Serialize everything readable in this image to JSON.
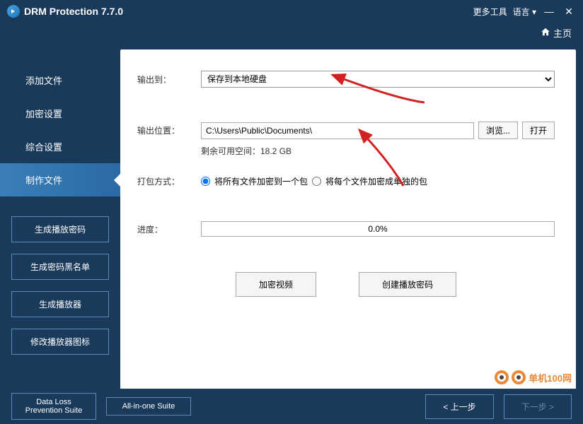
{
  "titlebar": {
    "title": "DRM Protection 7.7.0",
    "more_tools": "更多工具",
    "language": "语言"
  },
  "topbar": {
    "home": "主页"
  },
  "sidebar": {
    "nav": [
      {
        "label": "添加文件"
      },
      {
        "label": "加密设置"
      },
      {
        "label": "综合设置"
      },
      {
        "label": "制作文件"
      }
    ],
    "buttons": [
      {
        "label": "生成播放密码"
      },
      {
        "label": "生成密码黑名单"
      },
      {
        "label": "生成播放器"
      },
      {
        "label": "修改播放器图标"
      }
    ]
  },
  "form": {
    "output_to_label": "输出到：",
    "output_to_value": "保存到本地硬盘",
    "output_loc_label": "输出位置：",
    "output_loc_value": "C:\\Users\\Public\\Documents\\",
    "browse": "浏览...",
    "open": "打开",
    "freespace": "剩余可用空间：18.2 GB",
    "pack_label": "打包方式：",
    "pack_opt1": "将所有文件加密到一个包",
    "pack_opt2": "将每个文件加密成单独的包",
    "progress_label": "进度：",
    "progress_value": "0.0%",
    "encrypt_btn": "加密视频",
    "create_code_btn": "创建播放密码"
  },
  "footer": {
    "suite1": "Data Loss Prevention Suite",
    "suite2": "All-in-one Suite",
    "prev": "< 上一步",
    "next": "下一步 >"
  },
  "watermark": "单机100网"
}
